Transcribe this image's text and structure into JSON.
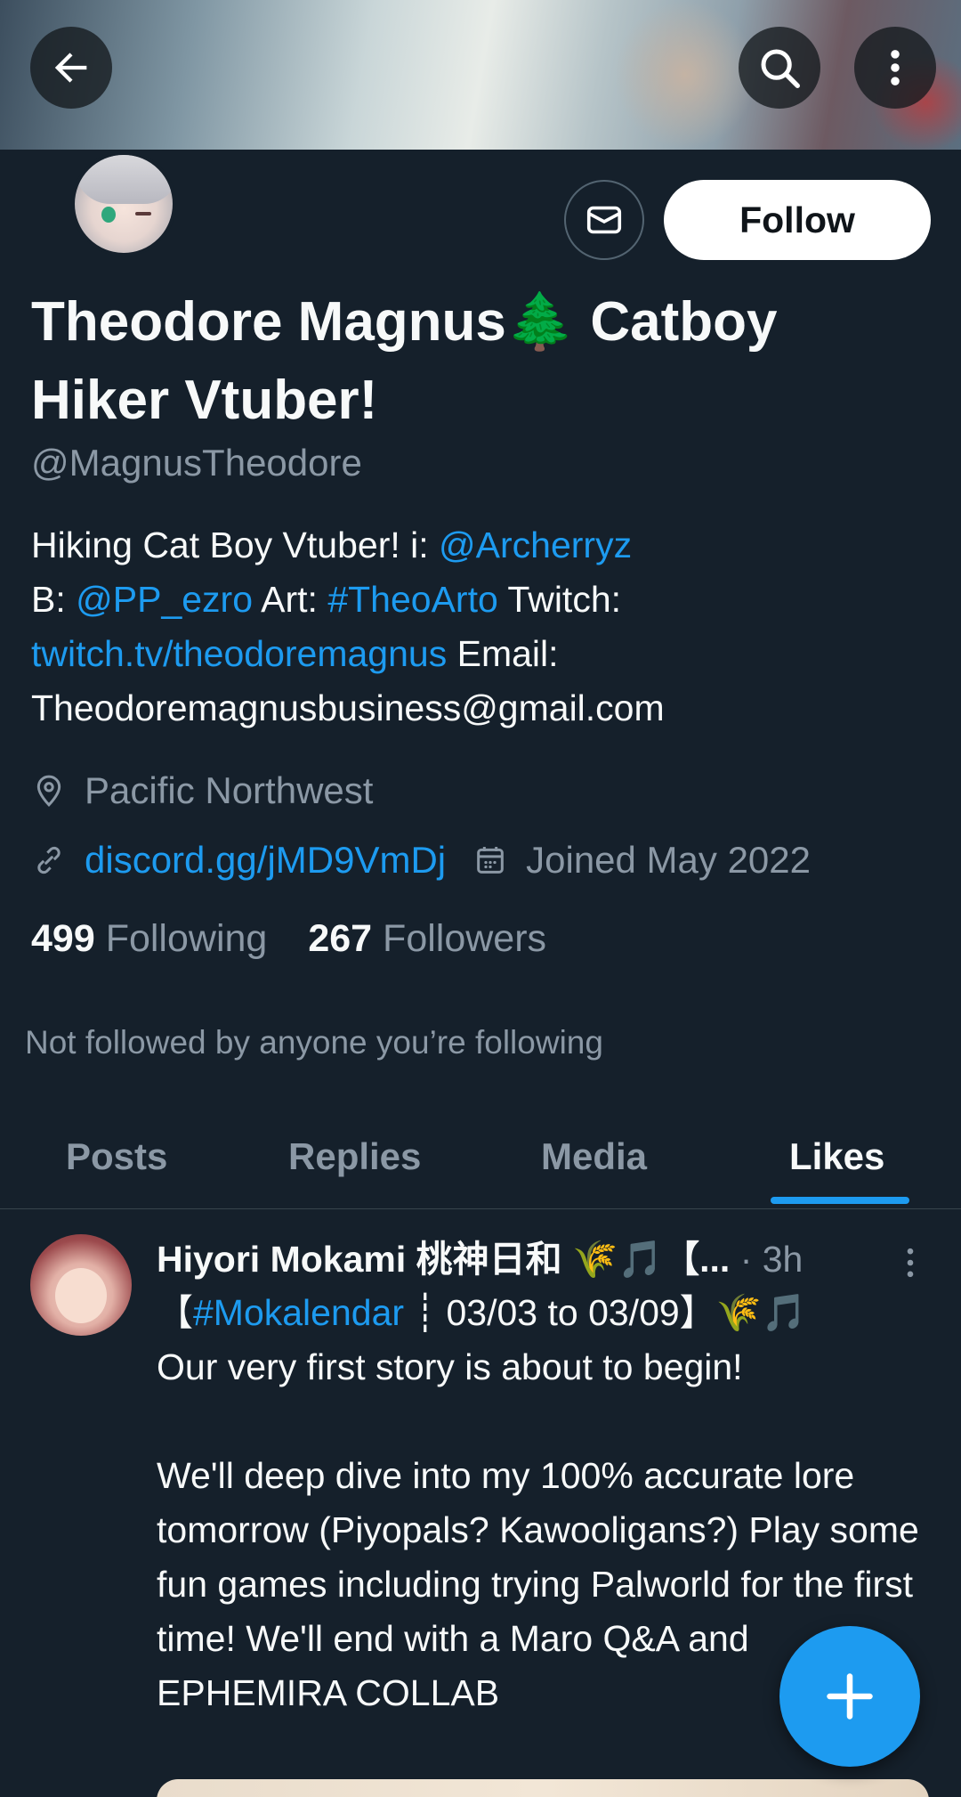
{
  "header": {
    "back_icon": "arrow-left-icon",
    "search_icon": "search-icon",
    "more_icon": "more-vertical-icon"
  },
  "profile": {
    "name": "Theodore Magnus🌲 Catboy Hiker Vtuber!",
    "handle": "@MagnusTheodore",
    "follow_label": "Follow",
    "bio": {
      "part1": "Hiking Cat Boy Vtuber! i: ",
      "link1": "@Archerryz",
      "part2": "B: ",
      "link2": "@PP_ezro",
      "part3": " Art: ",
      "link3": "#TheoArto",
      "part4": "  Twitch:",
      "link4": "twitch.tv/theodoremagnus",
      "part5": "  Email:",
      "part6": "Theodoremagnusbusiness@gmail.com"
    },
    "location": "Pacific Northwest",
    "website": "discord.gg/jMD9VmDj",
    "joined": "Joined May 2022",
    "following_count": "499",
    "following_label": "Following",
    "followers_count": "267",
    "followers_label": "Followers",
    "not_followed_text": "Not followed by anyone you’re following"
  },
  "tabs": [
    {
      "label": "Posts"
    },
    {
      "label": "Replies"
    },
    {
      "label": "Media"
    },
    {
      "label": "Likes"
    }
  ],
  "active_tab": "Likes",
  "post": {
    "author": "Hiyori Mokami 桃神日和 🌾🎵【...",
    "time": "· 3h",
    "line1_prefix": "【",
    "line1_tag": "#Mokalendar",
    "line1_suffix": " ┊ 03/03 to 03/09】🌾🎵",
    "body": "\nOur very first story is about to begin!\n\nWe'll deep dive into my 100% accurate lore tomorrow (Piyopals? Kawooligans?) Play some fun games including trying Palworld for the first time! We'll end with a Maro Q&A and EPHEMIRA COLLAB"
  },
  "colors": {
    "background": "#15202b",
    "accent": "#1d9bf0",
    "secondary_text": "#8b98a5"
  }
}
